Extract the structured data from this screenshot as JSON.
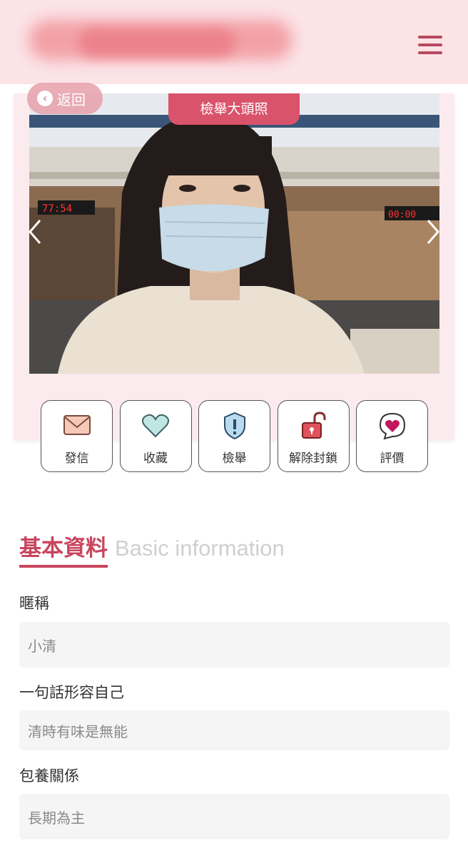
{
  "header": {
    "title_redacted": true,
    "menu_icon": "hamburger-icon"
  },
  "profile": {
    "back_label": "返回",
    "report_photo_label": "檢舉大頭照"
  },
  "actions": [
    {
      "label": "發信",
      "icon": "mail-icon"
    },
    {
      "label": "收藏",
      "icon": "heart-icon"
    },
    {
      "label": "檢舉",
      "icon": "shield-icon"
    },
    {
      "label": "解除封鎖",
      "icon": "unlock-icon"
    },
    {
      "label": "評價",
      "icon": "chat-heart-icon"
    }
  ],
  "basic_info": {
    "title_zh": "基本資料",
    "title_en": "Basic information",
    "fields": [
      {
        "label": "暱稱",
        "value": "小清"
      },
      {
        "label": "一句話形容自己",
        "value": "清時有味是無能"
      },
      {
        "label": "包養關係",
        "value": "長期為主"
      }
    ]
  },
  "colors": {
    "accent": "#c8455e",
    "header_bg": "#fbe3e6",
    "card_bg": "#fcebee"
  }
}
